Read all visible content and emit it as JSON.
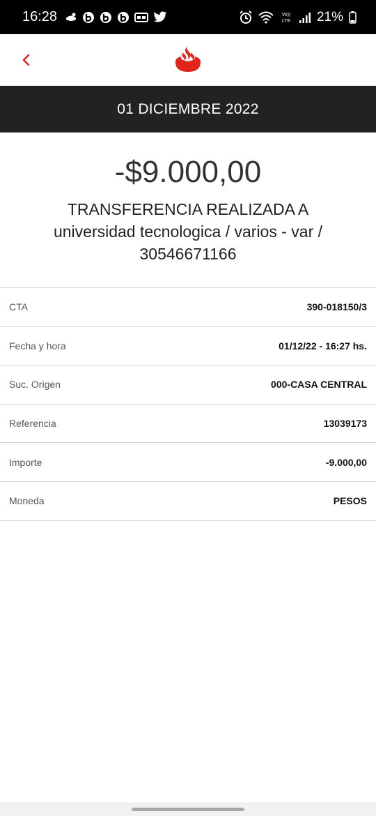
{
  "status_bar": {
    "time": "16:28",
    "battery": "21%",
    "notification_icons": [
      "chat-icon",
      "b-app-icon",
      "b-app-icon",
      "b-app-icon",
      "card-icon",
      "twitter-icon"
    ],
    "system_icons": [
      "alarm-icon",
      "wifi-icon",
      "volte-icon",
      "signal-icon",
      "battery-icon"
    ]
  },
  "header": {
    "back_icon": "chevron-left-icon",
    "logo_icon": "santander-flame-icon",
    "accent_color": "#e1251b"
  },
  "date_band": {
    "text": "01 DICIEMBRE 2022",
    "background": "#222222"
  },
  "transaction": {
    "amount": "-$9.000,00",
    "title": "TRANSFERENCIA REALIZADA A",
    "recipient": "universidad tecnologica / varios - var /",
    "recipient_id": "30546671166"
  },
  "details": [
    {
      "label": "CTA",
      "value": "390-018150/3"
    },
    {
      "label": "Fecha y hora",
      "value": "01/12/22 - 16:27 hs."
    },
    {
      "label": "Suc. Origen",
      "value": "000-CASA CENTRAL"
    },
    {
      "label": "Referencia",
      "value": "13039173"
    },
    {
      "label": "Importe",
      "value": "-9.000,00"
    },
    {
      "label": "Moneda",
      "value": "PESOS"
    }
  ]
}
